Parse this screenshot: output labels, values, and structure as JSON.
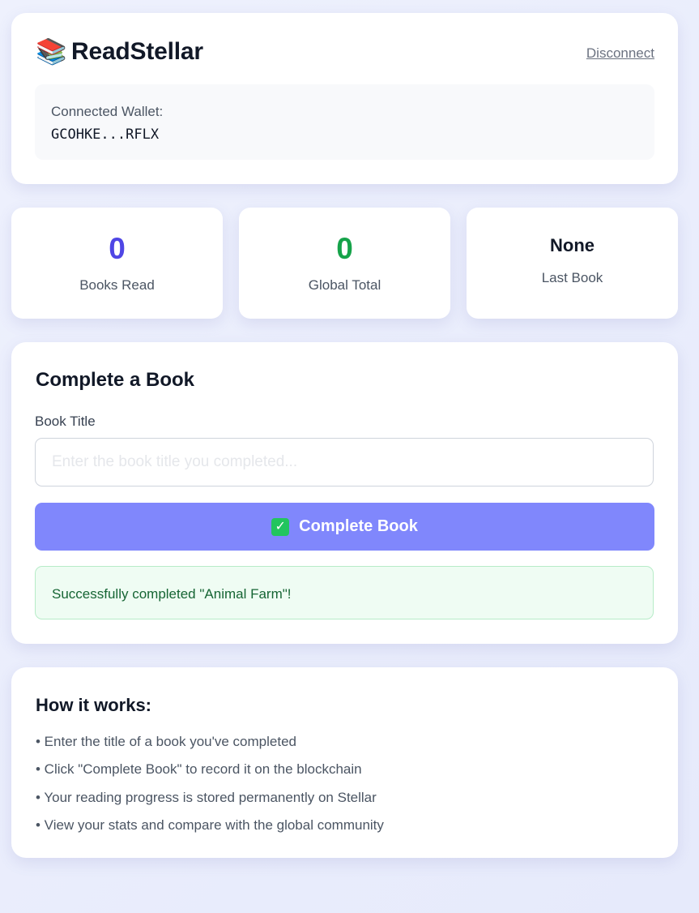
{
  "header": {
    "brand_icon": "books-icon",
    "brand_emoji": "📚",
    "app_title": "ReadStellar",
    "disconnect_label": "Disconnect",
    "wallet_label": "Connected Wallet:",
    "wallet_address": "GCOHKE...RFLX"
  },
  "stats": {
    "books_read": {
      "value": "0",
      "label": "Books Read"
    },
    "global_total": {
      "value": "0",
      "label": "Global Total"
    },
    "last_book": {
      "value": "None",
      "label": "Last Book"
    }
  },
  "complete": {
    "title": "Complete a Book",
    "field_label": "Book Title",
    "input_value": "",
    "input_placeholder": "Enter the book title you completed...",
    "button_icon": "check-icon",
    "button_label": "Complete Book",
    "success_message": "Successfully completed \"Animal Farm\"!"
  },
  "how_it_works": {
    "title": "How it works:",
    "items": [
      "• Enter the title of a book you've completed",
      "• Click \"Complete Book\" to record it on the blockchain",
      "• Your reading progress is stored permanently on Stellar",
      "• View your stats and compare with the global community"
    ]
  },
  "colors": {
    "accent": "#4f46e5",
    "button": "#8087fc",
    "success": "#16a34a",
    "success_bg": "#effcf3"
  }
}
